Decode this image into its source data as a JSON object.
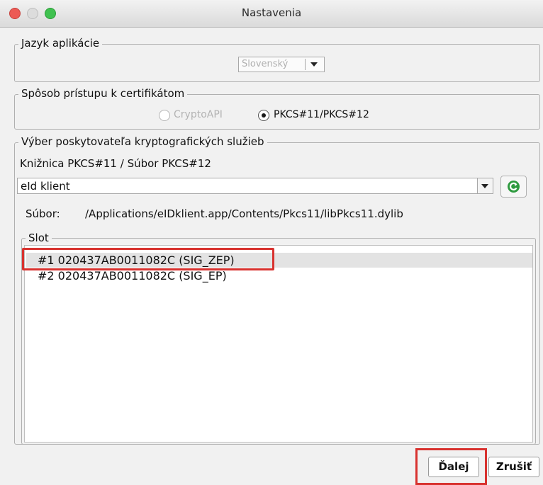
{
  "window": {
    "title": "Nastavenia"
  },
  "language_group": {
    "legend": "Jazyk aplikácie",
    "selected": "Slovenský"
  },
  "access_group": {
    "legend": "Spôsob prístupu k certifikátom",
    "options": [
      {
        "label": "CryptoAPI",
        "selected": false,
        "enabled": false
      },
      {
        "label": "PKCS#11/PKCS#12",
        "selected": true,
        "enabled": true
      }
    ]
  },
  "provider_group": {
    "legend": "Výber poskytovateľa kryptografických služieb",
    "library_label": "Knižnica PKCS#11 / Súbor PKCS#12",
    "library_selected": "eId klient",
    "file_label": "Súbor:",
    "file_path": "/Applications/eIDklient.app/Contents/Pkcs11/libPkcs11.dylib",
    "slot_legend": "Slot",
    "slots": [
      "#1 020437AB0011082C (SIG_ZEP)",
      "#2 020437AB0011082C (SIG_EP)"
    ]
  },
  "buttons": {
    "next": "Ďalej",
    "cancel": "Zrušiť"
  },
  "icons": {
    "refresh": "refresh-icon",
    "dropdown": "chevron-down-icon"
  },
  "colors": {
    "highlight": "#d8322f",
    "selected_row": "#e3e3e3",
    "refresh_green": "#2e9a3f"
  }
}
